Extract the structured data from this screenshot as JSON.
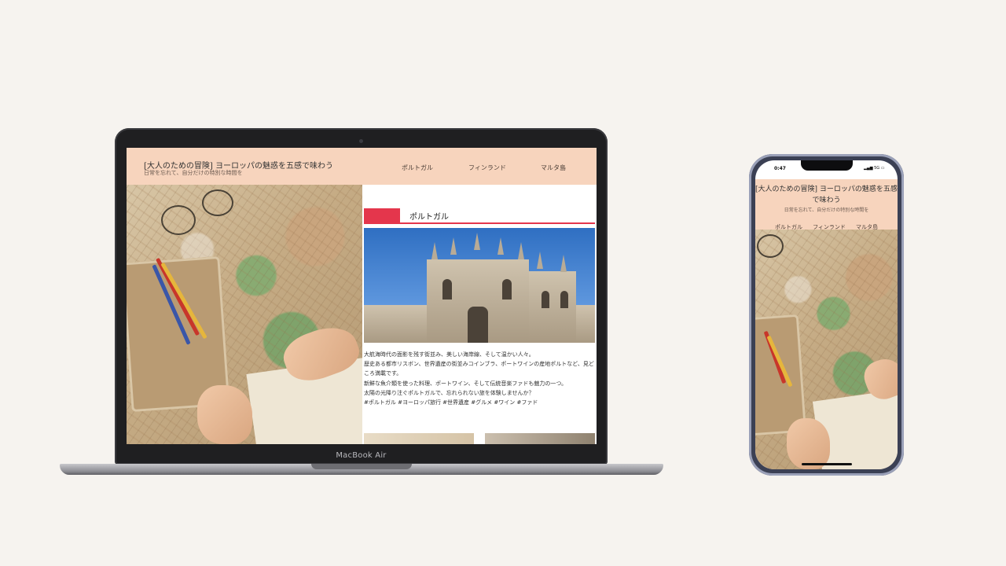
{
  "site": {
    "title": "[大人のための冒険] ヨーロッパの魅惑を五感で味わう",
    "subtitle": "日常を忘れて、自分だけの特別な時間を",
    "nav": [
      "ポルトガル",
      "フィンランド",
      "マルタ島"
    ]
  },
  "article": {
    "section_title": "ポルトガル",
    "body": [
      "大航海時代の面影を残す街並み、美しい海岸線、そして温かい人々。",
      "歴史ある都市リスボン、世界遺産の街並みコインブラ、ポートワインの産地ポルトなど、見どころ満載です。",
      "新鮮な魚介類を使った料理、ポートワイン、そして伝統音楽ファドも魅力の一つ。",
      "太陽の光降り注ぐポルトガルで、忘れられない旅を体験しませんか？",
      "#ポルトガル #ヨーロッパ旅行 #世界遺産 #グルメ #ワイン #ファド"
    ]
  },
  "device": {
    "laptop_label": "MacBook Air",
    "phone_time": "0:47",
    "phone_status": "▂▄▆ 5G ▭"
  },
  "colors": {
    "header_bg": "#f7d4bd",
    "accent": "#e4364c",
    "page_bg": "#f6f3ef"
  }
}
